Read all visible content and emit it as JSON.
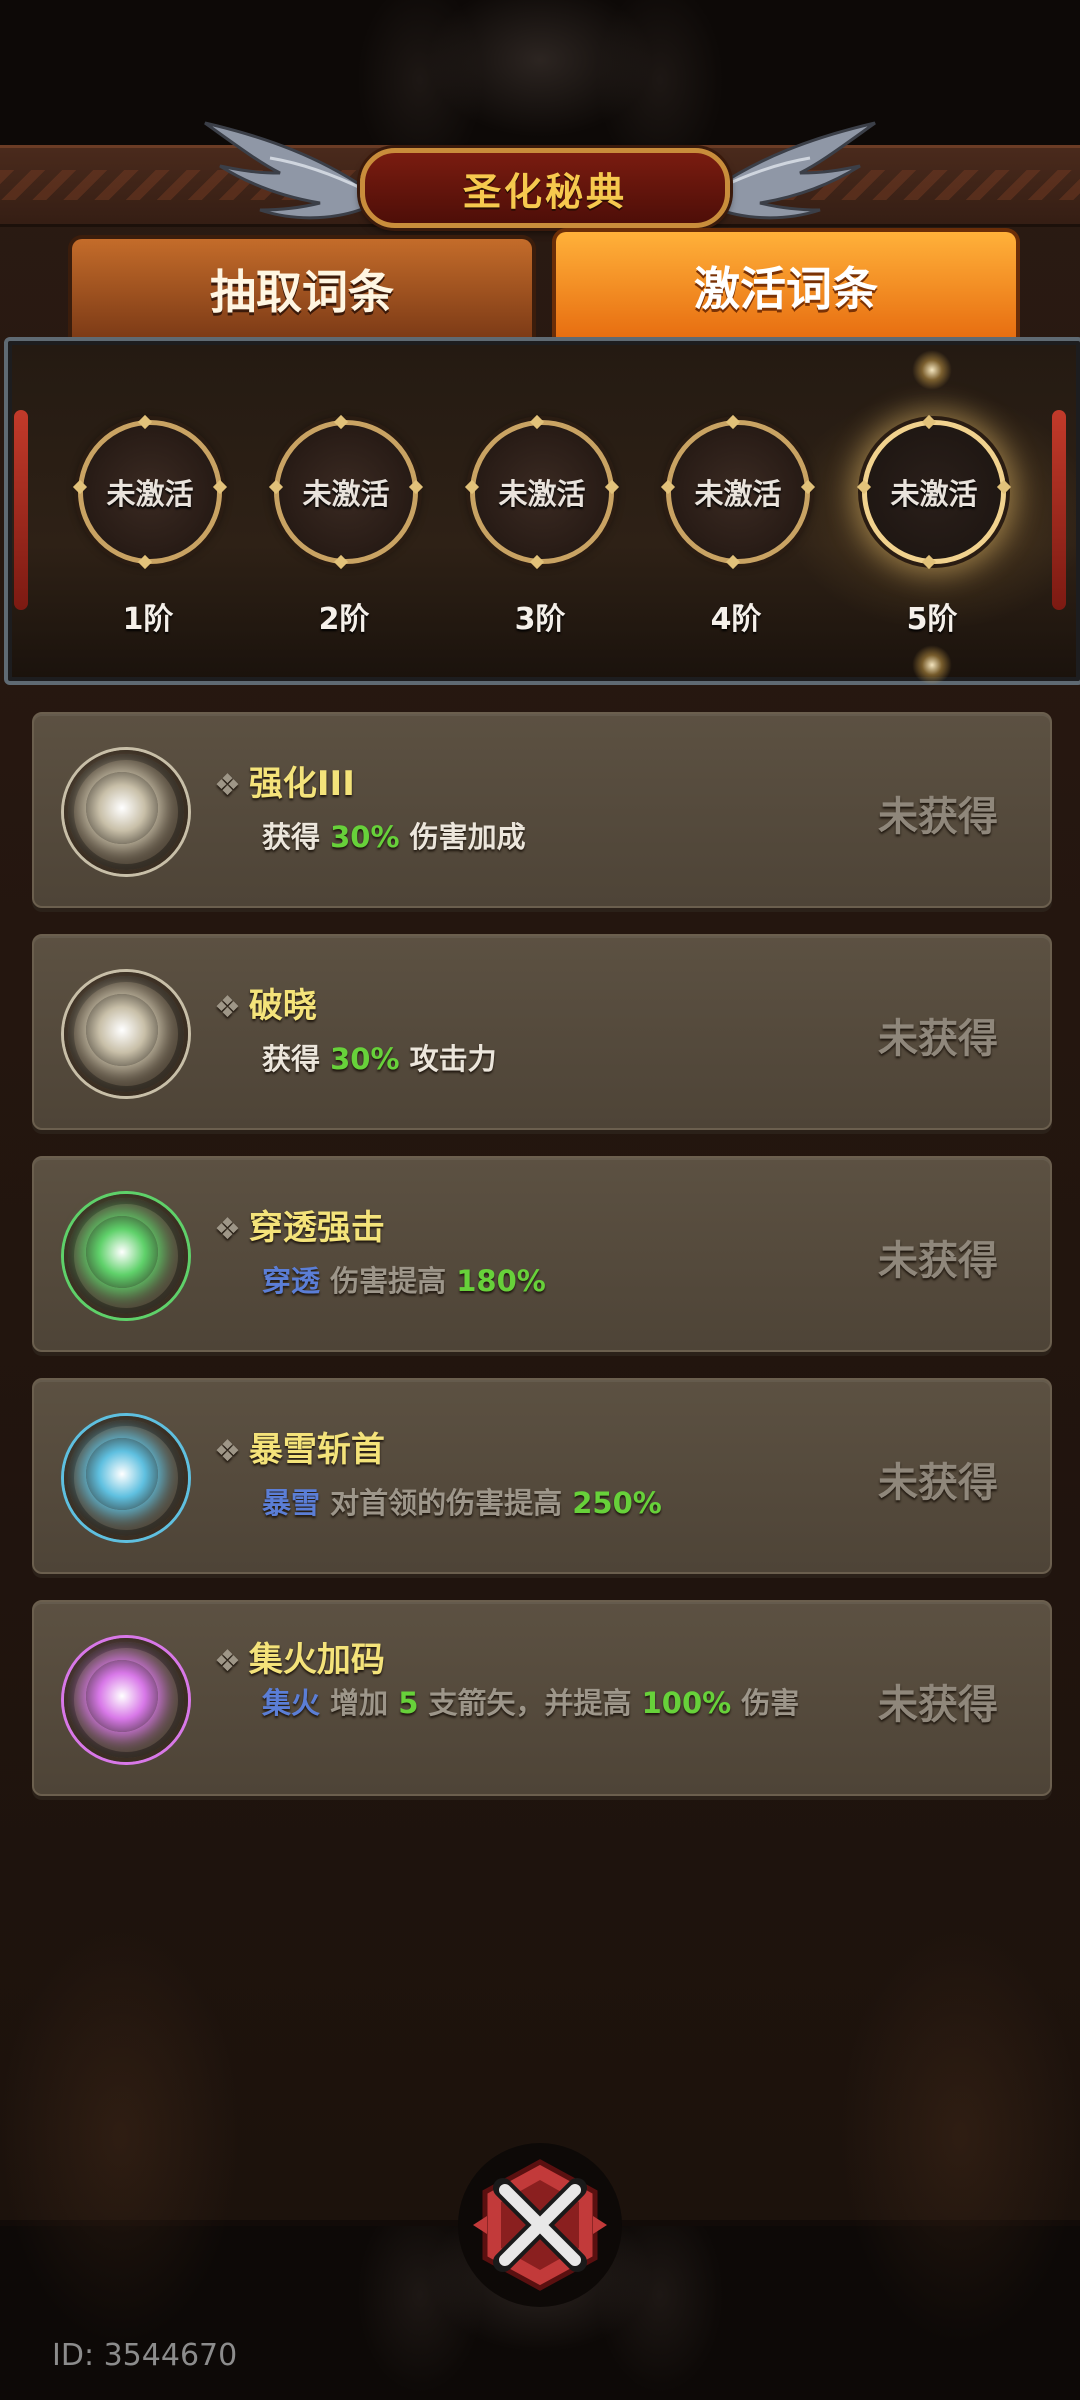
{
  "header": {
    "title": "圣化秘典"
  },
  "tabs": [
    {
      "label": "抽取词条",
      "active": false
    },
    {
      "label": "激活词条",
      "active": true
    }
  ],
  "tiers": [
    {
      "status": "未激活",
      "label": "1阶"
    },
    {
      "status": "未激活",
      "label": "2阶"
    },
    {
      "status": "未激活",
      "label": "3阶"
    },
    {
      "status": "未激活",
      "label": "4阶"
    },
    {
      "status": "未激活",
      "label": "5阶",
      "highlighted": true
    }
  ],
  "affixes": [
    {
      "name": "强化III",
      "orb_color": "#c8bfa8",
      "desc": [
        {
          "text": "获得 ",
          "style": "white"
        },
        {
          "text": "30%",
          "style": "green"
        },
        {
          "text": " 伤害加成",
          "style": "white"
        }
      ],
      "status": "未获得"
    },
    {
      "name": "破晓",
      "orb_color": "#c8bfa8",
      "desc": [
        {
          "text": "获得 ",
          "style": "white"
        },
        {
          "text": "30%",
          "style": "green"
        },
        {
          "text": " 攻击力",
          "style": "white"
        }
      ],
      "status": "未获得"
    },
    {
      "name": "穿透强击",
      "orb_color": "#5fd16a",
      "desc": [
        {
          "text": "穿透",
          "style": "blue"
        },
        {
          "text": " 伤害提高 ",
          "style": "gray"
        },
        {
          "text": "180%",
          "style": "green"
        }
      ],
      "status": "未获得"
    },
    {
      "name": "暴雪斩首",
      "orb_color": "#5fc0e0",
      "desc": [
        {
          "text": "暴雪",
          "style": "blue"
        },
        {
          "text": " 对首领的伤害提高 ",
          "style": "gray"
        },
        {
          "text": "250%",
          "style": "green"
        }
      ],
      "status": "未获得"
    },
    {
      "name": "集火加码",
      "orb_color": "#d878e8",
      "desc": [
        {
          "text": "集火",
          "style": "blue"
        },
        {
          "text": " 增加 ",
          "style": "gray"
        },
        {
          "text": "5",
          "style": "green"
        },
        {
          "text": " 支箭矢，并提高 ",
          "style": "gray"
        },
        {
          "text": "100%",
          "style": "green"
        },
        {
          "text": " 伤害",
          "style": "gray"
        }
      ],
      "status": "未获得"
    }
  ],
  "footer": {
    "user_id": "ID: 3544670"
  },
  "icons": {
    "close": "close-x-icon",
    "wings": "wing-icon"
  },
  "colors": {
    "accent": "#f6c94e",
    "green_value": "#67d13a",
    "blue_keyword": "#5b7ed6"
  }
}
